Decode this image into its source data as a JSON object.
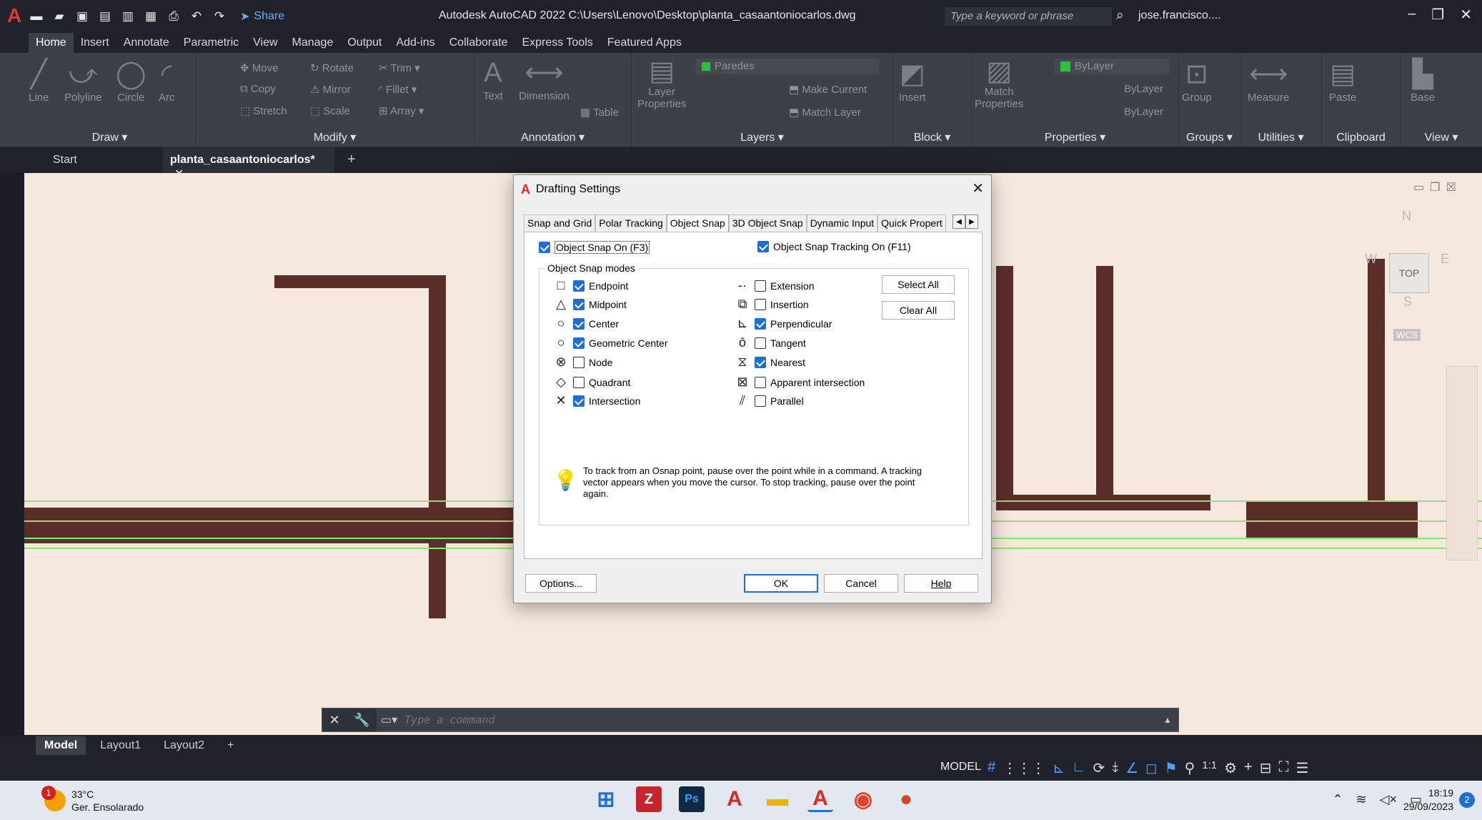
{
  "titlebar": {
    "share_label": "Share",
    "window_title": "Autodesk AutoCAD 2022   C:\\Users\\Lenovo\\Desktop\\planta_casaantoniocarlos.dwg",
    "search_placeholder": "Type a keyword or phrase",
    "user": "jose.francisco...."
  },
  "ribbon_tabs": [
    "Home",
    "Insert",
    "Annotate",
    "Parametric",
    "View",
    "Manage",
    "Output",
    "Add-ins",
    "Collaborate",
    "Express Tools",
    "Featured Apps"
  ],
  "ribbon": {
    "draw": {
      "label": "Draw ▾",
      "line": "Line",
      "polyline": "Polyline",
      "circle": "Circle",
      "arc": "Arc"
    },
    "modify": {
      "label": "Modify ▾",
      "move": "Move",
      "rotate": "Rotate",
      "trim": "Trim",
      "copy": "Copy",
      "mirror": "Mirror",
      "fillet": "Fillet",
      "stretch": "Stretch",
      "scale": "Scale",
      "array": "Array"
    },
    "annotation": {
      "label": "Annotation ▾",
      "text": "Text",
      "dimension": "Dimension",
      "table": "Table"
    },
    "layers": {
      "label": "Layers ▾",
      "properties": "Layer\nProperties",
      "layer_name": "Paredes",
      "make_current": "Make Current",
      "match_layer": "Match Layer"
    },
    "block": {
      "label": "Block ▾",
      "insert": "Insert"
    },
    "properties": {
      "label": "Properties ▾",
      "match": "Match\nProperties",
      "bylayer1": "ByLayer",
      "bylayer2": "ByLayer",
      "bylayer3": "ByLayer"
    },
    "groups": {
      "label": "Groups ▾",
      "group": "Group"
    },
    "utilities": {
      "label": "Utilities ▾",
      "measure": "Measure"
    },
    "clipboard": {
      "label": "Clipboard",
      "paste": "Paste"
    },
    "view": {
      "label": "View ▾",
      "base": "Base"
    }
  },
  "doc_tabs": {
    "start": "Start",
    "file": "planta_casaantoniocarlos*"
  },
  "viewcube": {
    "top": "TOP",
    "n": "N",
    "s": "S",
    "e": "E",
    "w": "W",
    "wcs": "WCS"
  },
  "dialog": {
    "title": "Drafting Settings",
    "tabs": [
      "Snap and Grid",
      "Polar Tracking",
      "Object Snap",
      "3D Object Snap",
      "Dynamic Input",
      "Quick Propert"
    ],
    "osnap_on": "Object Snap On (F3)",
    "tracking_on": "Object Snap Tracking On (F11)",
    "modes_label": "Object Snap modes",
    "left_modes": [
      {
        "label": "Endpoint",
        "checked": true
      },
      {
        "label": "Midpoint",
        "checked": true
      },
      {
        "label": "Center",
        "checked": true
      },
      {
        "label": "Geometric Center",
        "checked": true
      },
      {
        "label": "Node",
        "checked": false
      },
      {
        "label": "Quadrant",
        "checked": false
      },
      {
        "label": "Intersection",
        "checked": true
      }
    ],
    "right_modes": [
      {
        "label": "Extension",
        "checked": false
      },
      {
        "label": "Insertion",
        "checked": false
      },
      {
        "label": "Perpendicular",
        "checked": true
      },
      {
        "label": "Tangent",
        "checked": false
      },
      {
        "label": "Nearest",
        "checked": true
      },
      {
        "label": "Apparent intersection",
        "checked": false
      },
      {
        "label": "Parallel",
        "checked": false
      }
    ],
    "select_all": "Select All",
    "clear_all": "Clear All",
    "tip": "To track from an Osnap point, pause over the point while in a command.  A tracking vector appears when you move the cursor.  To stop tracking, pause over the point again.",
    "options": "Options...",
    "ok": "OK",
    "cancel": "Cancel",
    "help": "Help"
  },
  "command": {
    "placeholder": "Type a command"
  },
  "layout_tabs": [
    "Model",
    "Layout1",
    "Layout2"
  ],
  "status": {
    "model": "MODEL",
    "scale": "1:1"
  },
  "taskbar": {
    "temp": "33°C",
    "weather": "Ger. Ensolarado",
    "weather_badge": "1",
    "time": "18:19",
    "date": "29/09/2023",
    "notifications": "2"
  }
}
